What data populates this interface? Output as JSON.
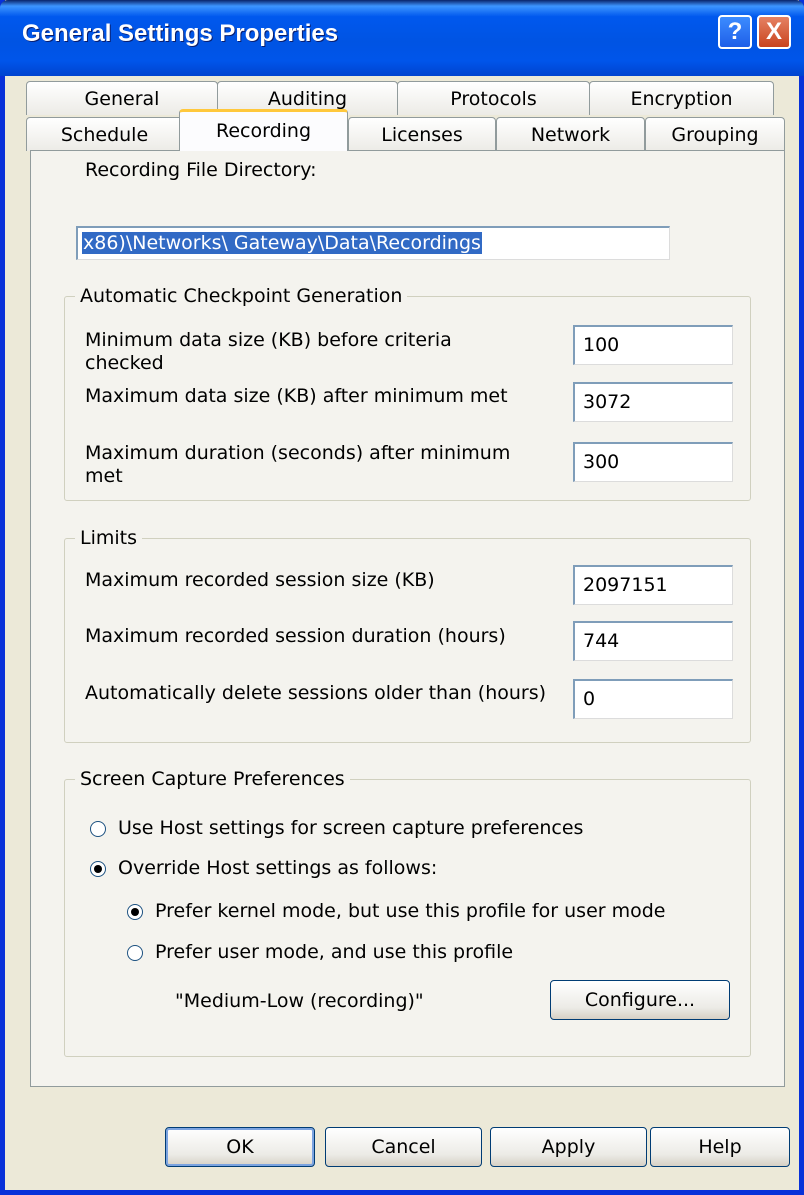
{
  "window": {
    "title": "General Settings Properties",
    "help_label": "?",
    "close_label": "X"
  },
  "tabs": {
    "row1": [
      "General",
      "Auditing",
      "Protocols",
      "Encryption"
    ],
    "row2": [
      "Schedule",
      "Recording",
      "Licenses",
      "Network",
      "Grouping"
    ],
    "active": "Recording"
  },
  "recording": {
    "dir_label": "Recording File Directory:",
    "dir_value": "x86)\\Networks\\ Gateway\\Data\\Recordings"
  },
  "checkpoint": {
    "legend": "Automatic Checkpoint Generation",
    "min_size_label": "Minimum data size (KB) before criteria checked",
    "min_size_value": "100",
    "max_size_label": "Maximum data size (KB) after minimum met",
    "max_size_value": "3072",
    "max_duration_label": "Maximum duration (seconds) after minimum met",
    "max_duration_value": "300"
  },
  "limits": {
    "legend": "Limits",
    "session_size_label": "Maximum recorded session size (KB)",
    "session_size_value": "2097151",
    "session_duration_label": "Maximum recorded session duration (hours)",
    "session_duration_value": "744",
    "delete_older_label": "Automatically delete sessions older than (hours)",
    "delete_older_value": "0"
  },
  "capture": {
    "legend": "Screen Capture Preferences",
    "use_host_label": "Use Host settings for screen capture preferences",
    "use_host_checked": false,
    "override_label": "Override Host settings as follows:",
    "override_checked": true,
    "kernel_label": "Prefer kernel mode, but use this profile for user mode",
    "kernel_checked": true,
    "user_label": "Prefer user mode, and use this profile",
    "user_checked": false,
    "profile_name": "\"Medium-Low (recording)\"",
    "configure_label": "Configure..."
  },
  "buttons": {
    "ok": "OK",
    "cancel": "Cancel",
    "apply": "Apply",
    "help": "Help"
  },
  "colors": {
    "title_bar": "#0054e3",
    "window_face": "#ece9d8",
    "selection": "#316ac5",
    "active_tab_accent": "#ffc83c"
  }
}
